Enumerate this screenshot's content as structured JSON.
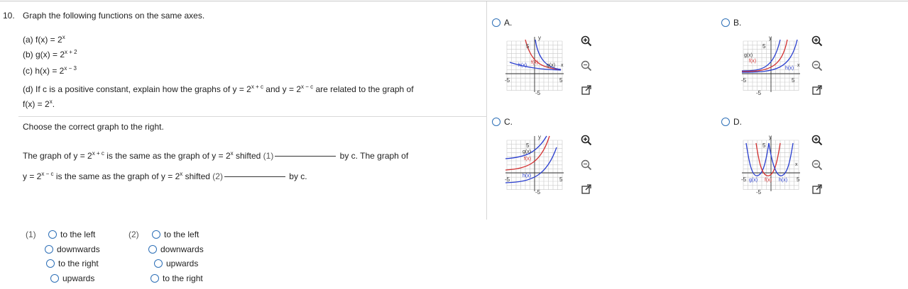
{
  "question": {
    "number": "10.",
    "prompt": "Graph the following functions on the same axes.",
    "part_a_prefix": "(a) f(x) = 2",
    "part_a_exp": "x",
    "part_b_prefix": "(b) g(x) = 2",
    "part_b_exp": "x + 2",
    "part_c_prefix": "(c) h(x) = 2",
    "part_c_exp": "x − 3",
    "part_d_1": "(d) If c is a positive constant, explain how the graphs of y = 2",
    "part_d_exp1": "x + c",
    "part_d_2": " and y = 2",
    "part_d_exp2": "x − c",
    "part_d_3": " are related to the graph of",
    "part_d_4": "f(x) = 2",
    "part_d_exp3": "x",
    "part_d_5": ".",
    "choose_text": "Choose the correct graph to the right.",
    "sentence1_a": "The graph of y = 2",
    "sentence1_exp1": "x + c",
    "sentence1_b": " is the same as the graph of y = 2",
    "sentence1_exp2": "x",
    "sentence1_c": " shifted ",
    "sentence1_num": "(1)",
    "sentence1_d": " by c. The graph of",
    "sentence2_a": "y = 2",
    "sentence2_exp1": "x − c",
    "sentence2_b": " is the same as the graph of y = 2",
    "sentence2_exp2": "x",
    "sentence2_c": " shifted ",
    "sentence2_num": "(2)",
    "sentence2_d": " by c."
  },
  "dropdown1": {
    "label": "(1)",
    "options": [
      "to the left",
      "downwards",
      "to the right",
      "upwards"
    ]
  },
  "dropdown2": {
    "label": "(2)",
    "options": [
      "to the left",
      "downwards",
      "upwards",
      "to the right"
    ]
  },
  "graph_options": [
    {
      "letter": "A.",
      "labels": {
        "y": "y",
        "five_top": "5",
        "neg_five_left": "-5",
        "five_right": "5",
        "neg_five_bottom": "-5",
        "x": "x",
        "curve1": "h(x)",
        "curve2": "f(x)",
        "curve3": "g(x)"
      }
    },
    {
      "letter": "B.",
      "labels": {
        "y": "y",
        "five_top": "5",
        "neg_five_left": "-5",
        "five_right": "5",
        "neg_five_bottom": "-5",
        "x": "x",
        "curve1": "g(x)",
        "curve2": "f(x)",
        "curve3": "h(x)"
      }
    },
    {
      "letter": "C.",
      "labels": {
        "y": "y",
        "five_top": "5",
        "neg_five_left": "-5",
        "five_right": "5",
        "neg_five_bottom": "-5",
        "x": "x",
        "curve1": "g(x)",
        "curve2": "f(x)",
        "curve3": "h(x)"
      }
    },
    {
      "letter": "D.",
      "labels": {
        "y": "y",
        "five_top": "5",
        "neg_five_left": "-5",
        "five_right": "5",
        "neg_five_bottom": "-5",
        "x": "x",
        "curve1": "g(x)",
        "curve2": "f(x)",
        "curve3": "h(x)"
      }
    }
  ],
  "icons": {
    "zoom_in": "zoom-in-icon",
    "zoom_out": "zoom-out-icon",
    "popout": "popout-icon"
  },
  "colors": {
    "radio": "#2d6fb7",
    "curve_red": "#d43030",
    "curve_blue": "#2a3fd0"
  }
}
